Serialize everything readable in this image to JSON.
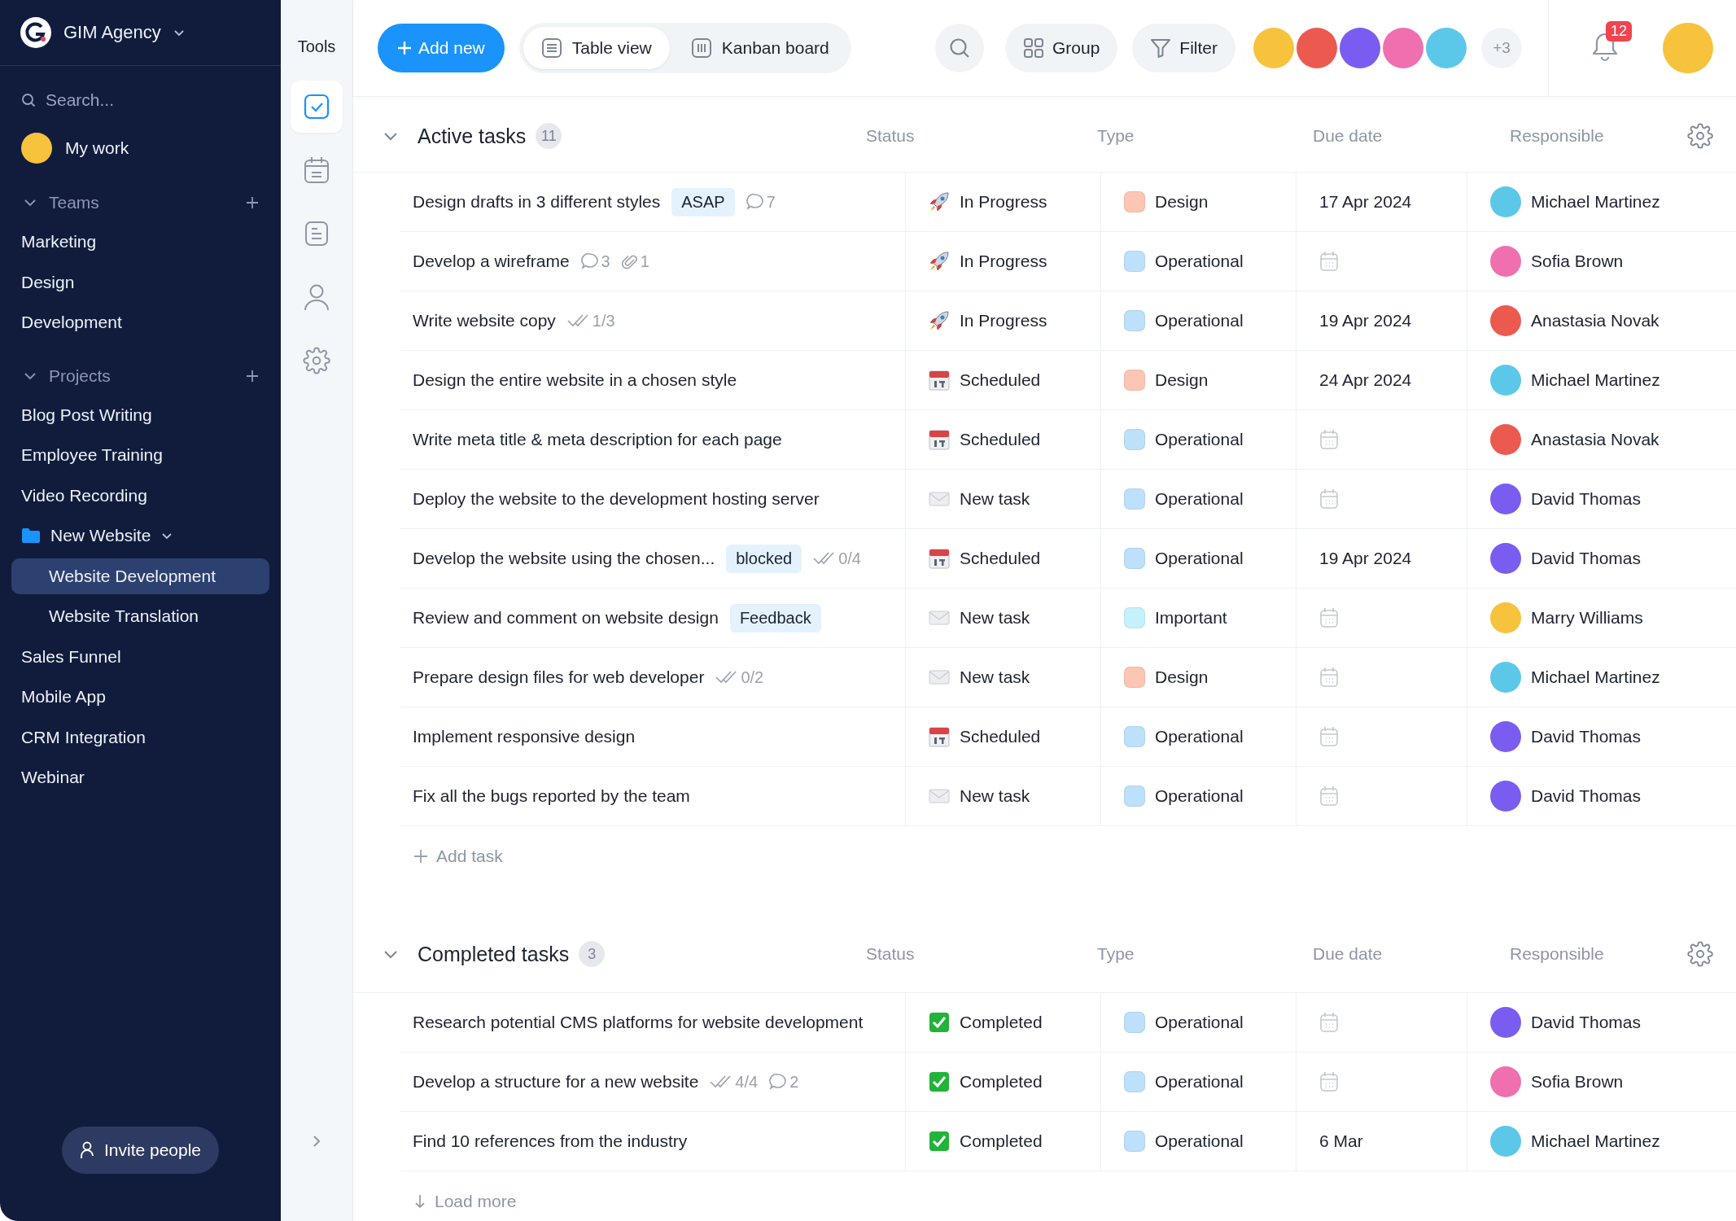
{
  "sidebar": {
    "workspace": "GIM Agency",
    "search_placeholder": "Search...",
    "my_work": {
      "label": "My work"
    },
    "groups": [
      {
        "title": "Teams",
        "expanded": true,
        "items": [
          {
            "label": "Marketing",
            "selected": false
          },
          {
            "label": "Design",
            "selected": false
          },
          {
            "label": "Development",
            "selected": false
          }
        ]
      },
      {
        "title": "Projects",
        "expanded": true,
        "items": [
          {
            "label": "Blog Post Writing",
            "selected": false
          },
          {
            "label": "Employee Training",
            "selected": false
          },
          {
            "label": "Video Recording",
            "selected": false
          },
          {
            "label": "New Website",
            "kind": "folder",
            "expanded": true,
            "selected": false,
            "children": [
              {
                "label": "Website Development",
                "selected": true
              },
              {
                "label": "Website Translation",
                "selected": false
              }
            ]
          },
          {
            "label": "Sales Funnel",
            "selected": false
          },
          {
            "label": "Mobile App",
            "selected": false
          },
          {
            "label": "CRM Integration",
            "selected": false
          },
          {
            "label": "Webinar",
            "selected": false
          }
        ]
      }
    ],
    "invite": "Invite people"
  },
  "tools": {
    "title": "Tools",
    "items": [
      {
        "kind": "tasks",
        "selected": true
      },
      {
        "kind": "calendar",
        "selected": false
      },
      {
        "kind": "notes",
        "selected": false
      },
      {
        "kind": "people",
        "selected": false
      },
      {
        "kind": "settings",
        "selected": false
      }
    ]
  },
  "toolbar": {
    "add_button": "Add new",
    "views": [
      {
        "label": "Table view",
        "kind": "table",
        "selected": true
      },
      {
        "label": "Kanban board",
        "kind": "kanban",
        "selected": false
      }
    ],
    "group": "Group",
    "filter": "Filter",
    "members": [
      {
        "color": "#f7c23c"
      },
      {
        "color": "#ec5a4f"
      },
      {
        "color": "#7b5cf0"
      },
      {
        "color": "#f06fae"
      },
      {
        "color": "#5bc8ea"
      }
    ],
    "more_members": "+3",
    "notifications": "12"
  },
  "sections": [
    {
      "title": "Active tasks",
      "count": "11",
      "expanded": true,
      "columns": [
        "Status",
        "Type",
        "Due date",
        "Responsible"
      ],
      "tasks": [
        {
          "title": "Design drafts in 3 different styles",
          "tag": "ASAP",
          "meta": [
            {
              "kind": "comments",
              "text": "7"
            }
          ],
          "status": {
            "kind": "in_progress",
            "label": "In Progress"
          },
          "type": {
            "label": "Design",
            "color": "#fdc5b3"
          },
          "due": "17 Apr 2024",
          "responsible": {
            "name": "Michael Martinez",
            "color": "#5bc8ea"
          }
        },
        {
          "title": "Develop a wireframe",
          "meta": [
            {
              "kind": "comments",
              "text": "3"
            },
            {
              "kind": "attachments",
              "text": "1"
            }
          ],
          "status": {
            "kind": "in_progress",
            "label": "In Progress"
          },
          "type": {
            "label": "Operational",
            "color": "#bde0fb"
          },
          "responsible": {
            "name": "Sofia Brown",
            "color": "#f06fae"
          }
        },
        {
          "title": "Write website copy",
          "meta": [
            {
              "kind": "checklist",
              "text": "1/3"
            }
          ],
          "status": {
            "kind": "in_progress",
            "label": "In Progress"
          },
          "type": {
            "label": "Operational",
            "color": "#bde0fb"
          },
          "due": "19 Apr 2024",
          "responsible": {
            "name": "Anastasia Novak",
            "color": "#ec5a4f"
          }
        },
        {
          "title": "Design the entire website in a chosen style",
          "status": {
            "kind": "scheduled",
            "label": "Scheduled"
          },
          "type": {
            "label": "Design",
            "color": "#fdc5b3"
          },
          "due": "24 Apr 2024",
          "responsible": {
            "name": "Michael Martinez",
            "color": "#5bc8ea"
          }
        },
        {
          "title": "Write meta title & meta description for each page",
          "status": {
            "kind": "scheduled",
            "label": "Scheduled"
          },
          "type": {
            "label": "Operational",
            "color": "#bde0fb"
          },
          "responsible": {
            "name": "Anastasia Novak",
            "color": "#ec5a4f"
          }
        },
        {
          "title": "Deploy the website to the development hosting server",
          "status": {
            "kind": "new",
            "label": "New task"
          },
          "type": {
            "label": "Operational",
            "color": "#bde0fb"
          },
          "responsible": {
            "name": "David Thomas",
            "color": "#7b5cf0"
          }
        },
        {
          "title": "Develop the website using the chosen...",
          "tag": "blocked",
          "meta": [
            {
              "kind": "checklist",
              "text": "0/4"
            }
          ],
          "status": {
            "kind": "scheduled",
            "label": "Scheduled"
          },
          "type": {
            "label": "Operational",
            "color": "#bde0fb"
          },
          "due": "19 Apr 2024",
          "responsible": {
            "name": "David Thomas",
            "color": "#7b5cf0"
          }
        },
        {
          "title": "Review and comment on website design",
          "tag": "Feedback",
          "status": {
            "kind": "new",
            "label": "New task"
          },
          "type": {
            "label": "Important",
            "color": "#c4f1fb"
          },
          "responsible": {
            "name": "Marry Williams",
            "color": "#f7c23c"
          }
        },
        {
          "title": "Prepare design files for web developer",
          "meta": [
            {
              "kind": "checklist",
              "text": "0/2"
            }
          ],
          "status": {
            "kind": "new",
            "label": "New task"
          },
          "type": {
            "label": "Design",
            "color": "#fdc5b3"
          },
          "responsible": {
            "name": "Michael Martinez",
            "color": "#5bc8ea"
          }
        },
        {
          "title": "Implement responsive design",
          "status": {
            "kind": "scheduled",
            "label": "Scheduled"
          },
          "type": {
            "label": "Operational",
            "color": "#bde0fb"
          },
          "responsible": {
            "name": "David Thomas",
            "color": "#7b5cf0"
          }
        },
        {
          "title": "Fix all the bugs reported by the team",
          "status": {
            "kind": "new",
            "label": "New task"
          },
          "type": {
            "label": "Operational",
            "color": "#bde0fb"
          },
          "responsible": {
            "name": "David Thomas",
            "color": "#7b5cf0"
          }
        }
      ],
      "footer": {
        "kind": "add",
        "label": "Add task"
      }
    },
    {
      "title": "Completed tasks",
      "count": "3",
      "expanded": true,
      "columns": [
        "Status",
        "Type",
        "Due date",
        "Responsible"
      ],
      "tasks": [
        {
          "title": "Research potential CMS platforms for website development",
          "status": {
            "kind": "completed",
            "label": "Completed"
          },
          "type": {
            "label": "Operational",
            "color": "#bde0fb"
          },
          "responsible": {
            "name": "David Thomas",
            "color": "#7b5cf0"
          }
        },
        {
          "title": "Develop a structure for a new website",
          "meta": [
            {
              "kind": "checklist",
              "text": "4/4"
            },
            {
              "kind": "comments",
              "text": "2"
            }
          ],
          "status": {
            "kind": "completed",
            "label": "Completed"
          },
          "type": {
            "label": "Operational",
            "color": "#bde0fb"
          },
          "responsible": {
            "name": "Sofia Brown",
            "color": "#f06fae"
          }
        },
        {
          "title": "Find 10 references from the industry",
          "status": {
            "kind": "completed",
            "label": "Completed"
          },
          "type": {
            "label": "Operational",
            "color": "#bde0fb"
          },
          "due": "6 Mar",
          "responsible": {
            "name": "Michael Martinez",
            "color": "#5bc8ea"
          }
        }
      ],
      "footer": {
        "kind": "load",
        "label": "Load more"
      }
    }
  ]
}
